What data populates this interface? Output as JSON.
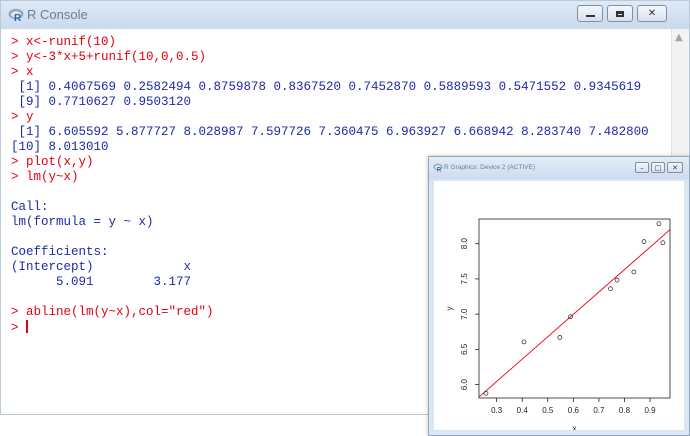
{
  "console": {
    "title": "R Console",
    "lines": [
      {
        "text": "> x<-runif(10)",
        "color": "red"
      },
      {
        "text": "> y<-3*x+5+runif(10,0,0.5)",
        "color": "red"
      },
      {
        "text": "> x",
        "color": "red"
      },
      {
        "text": " [1] 0.4067569 0.2582494 0.8759878 0.8367520 0.7452870 0.5889593 0.5471552 0.9345619",
        "color": "blue"
      },
      {
        "text": " [9] 0.7710627 0.9503120",
        "color": "blue"
      },
      {
        "text": "> y",
        "color": "red"
      },
      {
        "text": " [1] 6.605592 5.877727 8.028987 7.597726 7.360475 6.963927 6.668942 8.283740 7.482800",
        "color": "blue"
      },
      {
        "text": "[10] 8.013010",
        "color": "blue"
      },
      {
        "text": "> plot(x,y)",
        "color": "red"
      },
      {
        "text": "> lm(y~x)",
        "color": "red"
      },
      {
        "text": "",
        "color": "blue"
      },
      {
        "text": "Call:",
        "color": "blue"
      },
      {
        "text": "lm(formula = y ~ x)",
        "color": "blue"
      },
      {
        "text": "",
        "color": "blue"
      },
      {
        "text": "Coefficients:",
        "color": "blue"
      },
      {
        "text": "(Intercept)            x",
        "color": "blue"
      },
      {
        "text": "      5.091        3.177",
        "color": "blue"
      },
      {
        "text": "",
        "color": "blue"
      },
      {
        "text": "> abline(lm(y~x),col=\"red\")",
        "color": "red"
      }
    ],
    "prompt": "> ",
    "colors": {
      "input": "#e3000f",
      "output": "#1e2aa8"
    }
  },
  "graphics": {
    "title": "R Graphics: Device 2 (ACTIVE)"
  },
  "chart_data": {
    "type": "scatter",
    "title": "",
    "xlabel": "x",
    "ylabel": "y",
    "x": [
      0.4067569,
      0.2582494,
      0.8759878,
      0.836752,
      0.745287,
      0.5889593,
      0.5471552,
      0.9345619,
      0.7710627,
      0.950312
    ],
    "y": [
      6.605592,
      5.877727,
      8.028987,
      7.597726,
      7.360475,
      6.963927,
      6.668942,
      8.28374,
      7.4828,
      8.01301
    ],
    "xticks": [
      "0.3",
      "0.4",
      "0.5",
      "0.6",
      "0.7",
      "0.8",
      "0.9"
    ],
    "yticks": [
      "6.0",
      "6.5",
      "7.0",
      "7.5",
      "8.0"
    ],
    "xlim": [
      0.231,
      0.978
    ],
    "ylim": [
      5.81,
      8.35
    ],
    "regression_line": {
      "intercept": 5.091,
      "slope": 3.177,
      "color": "#e3000f"
    },
    "grid": false
  }
}
